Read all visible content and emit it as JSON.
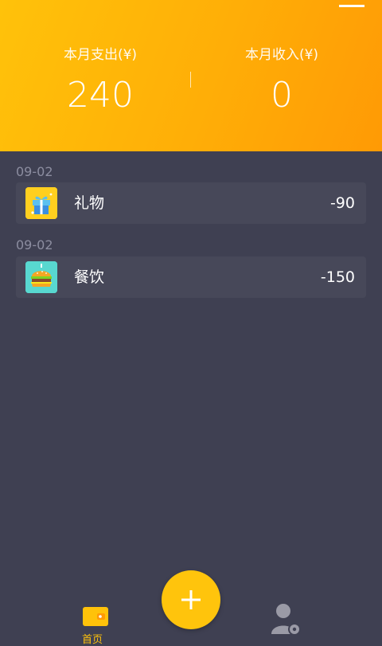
{
  "summary": {
    "expense_label": "本月支出(¥)",
    "expense_value": "240",
    "income_label": "本月收入(¥)",
    "income_value": "0"
  },
  "records": [
    {
      "date": "09-02",
      "category": "礼物",
      "amount": "-90",
      "icon": "gift-icon"
    },
    {
      "date": "09-02",
      "category": "餐饮",
      "amount": "-150",
      "icon": "burger-icon"
    }
  ],
  "tabbar": {
    "home_label": "首页",
    "home_icon": "wallet-icon",
    "me_icon": "user-settings-icon"
  },
  "colors": {
    "accent": "#ffc20a",
    "header_end": "#ff9a05",
    "background": "#3f4052",
    "card": "#474859",
    "date_text": "#8c8da0"
  }
}
